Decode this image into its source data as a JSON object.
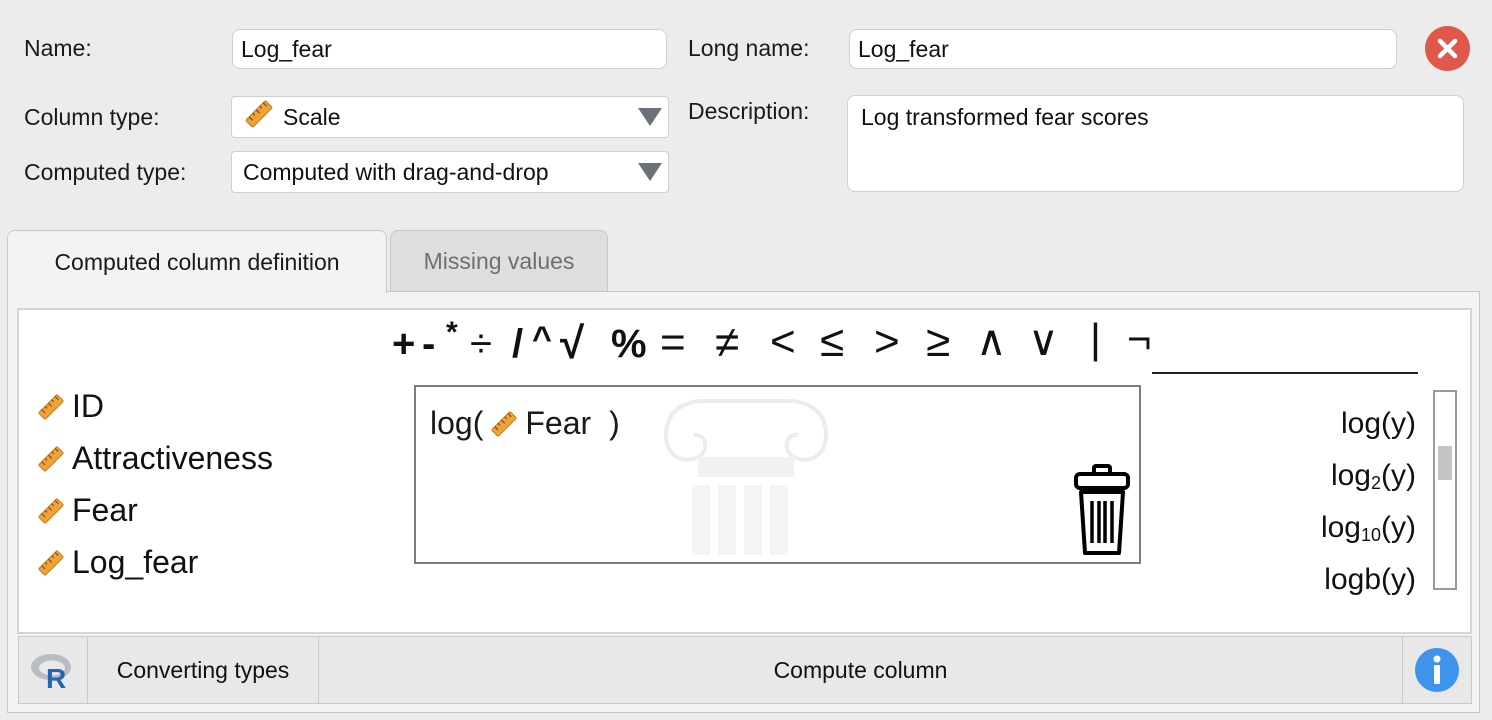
{
  "form": {
    "name_label": "Name:",
    "name_value": "Log_fear",
    "long_name_label": "Long name:",
    "long_name_value": "Log_fear",
    "column_type_label": "Column type:",
    "column_type_value": "Scale",
    "computed_type_label": "Computed type:",
    "computed_type_value": "Computed with drag-and-drop",
    "description_label": "Description:",
    "description_value": "Log transformed fear scores"
  },
  "tabs": [
    {
      "label": "Computed column definition",
      "active": true
    },
    {
      "label": "Missing values",
      "active": false
    }
  ],
  "operators": [
    "+",
    "-",
    "*",
    "÷",
    "/",
    "^",
    "√",
    "%",
    "=",
    "≠",
    "<",
    "≤",
    ">",
    "≥",
    "∧",
    "∨",
    "|",
    "¬"
  ],
  "columns": [
    "ID",
    "Attractiveness",
    "Fear",
    "Log_fear"
  ],
  "formula": {
    "func": "log(",
    "arg": "Fear",
    "close": ")"
  },
  "functions": [
    {
      "base": "log",
      "sub": "",
      "args": "(y)"
    },
    {
      "base": "log",
      "sub": "2",
      "args": "(y)"
    },
    {
      "base": "log",
      "sub": "10",
      "args": "(y)"
    },
    {
      "base": "logb",
      "sub": "",
      "args": "(y)"
    }
  ],
  "bottom": {
    "converting_label": "Converting types",
    "compute_label": "Compute column"
  },
  "icons": {
    "close": "close-icon",
    "scale": "ruler-icon",
    "trash": "trash-icon",
    "r": "r-logo-icon",
    "info": "info-icon"
  },
  "colors": {
    "close_red": "#e0584a",
    "ruler_orange": "#f0a23a",
    "info_blue": "#3d94ea",
    "r_blue": "#2265b5"
  }
}
